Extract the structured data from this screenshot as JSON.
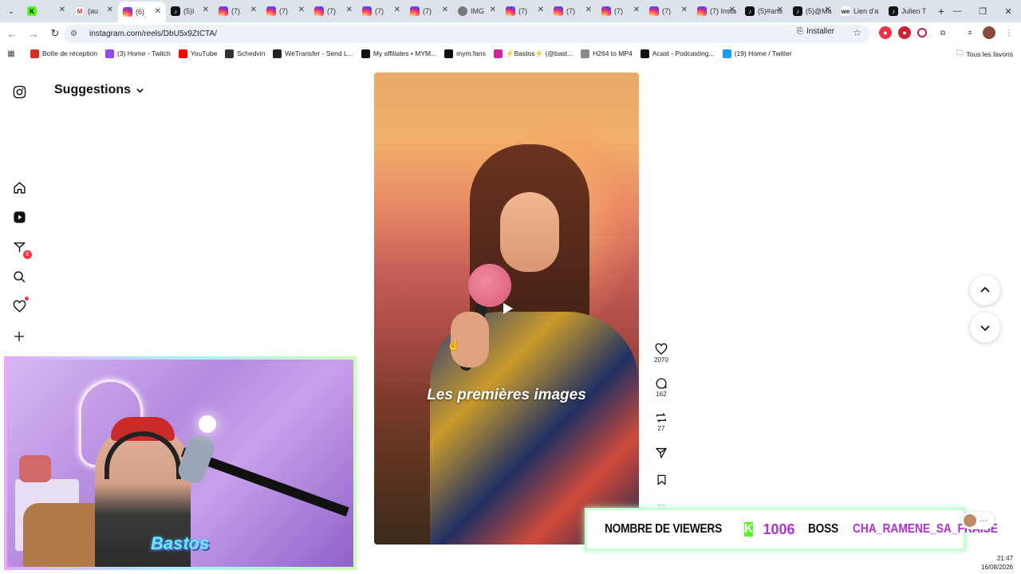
{
  "tabs": [
    {
      "label": "",
      "icon": "kick",
      "active": false
    },
    {
      "label": "(au",
      "icon": "gmail",
      "active": false
    },
    {
      "label": "(6)",
      "icon": "instagram",
      "active": true
    },
    {
      "label": "(5)I",
      "icon": "tiktok",
      "active": false
    },
    {
      "label": "(7)",
      "icon": "instagram",
      "active": false
    },
    {
      "label": "(7)",
      "icon": "instagram",
      "active": false
    },
    {
      "label": "(7)",
      "icon": "instagram",
      "active": false
    },
    {
      "label": "(7)",
      "icon": "instagram",
      "active": false
    },
    {
      "label": "(7)",
      "icon": "instagram",
      "active": false
    },
    {
      "label": "IMG",
      "icon": "globe",
      "active": false
    },
    {
      "label": "(7)",
      "icon": "instagram",
      "active": false
    },
    {
      "label": "(7)",
      "icon": "instagram",
      "active": false
    },
    {
      "label": "(7)",
      "icon": "instagram",
      "active": false
    },
    {
      "label": "(7)",
      "icon": "instagram",
      "active": false
    },
    {
      "label": "(7) Insta",
      "icon": "instagram",
      "active": false
    },
    {
      "label": "(5)#arts",
      "icon": "tiktok",
      "active": false
    },
    {
      "label": "(5)@Ma",
      "icon": "tiktok",
      "active": false
    },
    {
      "label": "Lien d'a",
      "icon": "wetransfer",
      "active": false
    },
    {
      "label": "Julien T",
      "icon": "tiktok",
      "active": false
    }
  ],
  "address": {
    "url": "instagram.com/reels/DbU5x9ZtCTA/",
    "install_label": "Installer"
  },
  "bookmarks": [
    {
      "label": "Boîte de réception",
      "color": "#d93025"
    },
    {
      "label": "(3) Home - Twitch",
      "color": "#9146ff"
    },
    {
      "label": "YouTube",
      "color": "#ff0000"
    },
    {
      "label": "Schedvin",
      "color": "#333333"
    },
    {
      "label": "WeTransfer - Send L...",
      "color": "#222222"
    },
    {
      "label": "My affiliates • MYM...",
      "color": "#111111"
    },
    {
      "label": "mym.fans",
      "color": "#111111"
    },
    {
      "label": "⚡Bastos⚡ (@bast...",
      "color": "#d6249f"
    },
    {
      "label": "H264 to MP4",
      "color": "#888888"
    },
    {
      "label": "Acast - Podcasting...",
      "color": "#111111"
    },
    {
      "label": "(19) Home / Twitter",
      "color": "#1d9bf0"
    }
  ],
  "bookmarks_all": "Tous les favoris",
  "page": {
    "title": "Suggestions",
    "reel_caption": "Les premières images",
    "likes": "2070",
    "comments": "162",
    "reposts": "27",
    "notifications_badge": "6"
  },
  "banner": {
    "label": "NOMBRE DE VIEWERS",
    "kick_letter": "K",
    "count": "1006",
    "boss_label": "BOSS",
    "boss_name": "CHA_RAMENE_SA_FRAISE"
  },
  "webcam": {
    "logo_text": "Bastos"
  },
  "clock": {
    "time": "21:47",
    "date": "16/08/2026"
  },
  "colors": {
    "accent": "#b12fd6",
    "kick": "#53fc18",
    "badge": "#ff3040"
  }
}
